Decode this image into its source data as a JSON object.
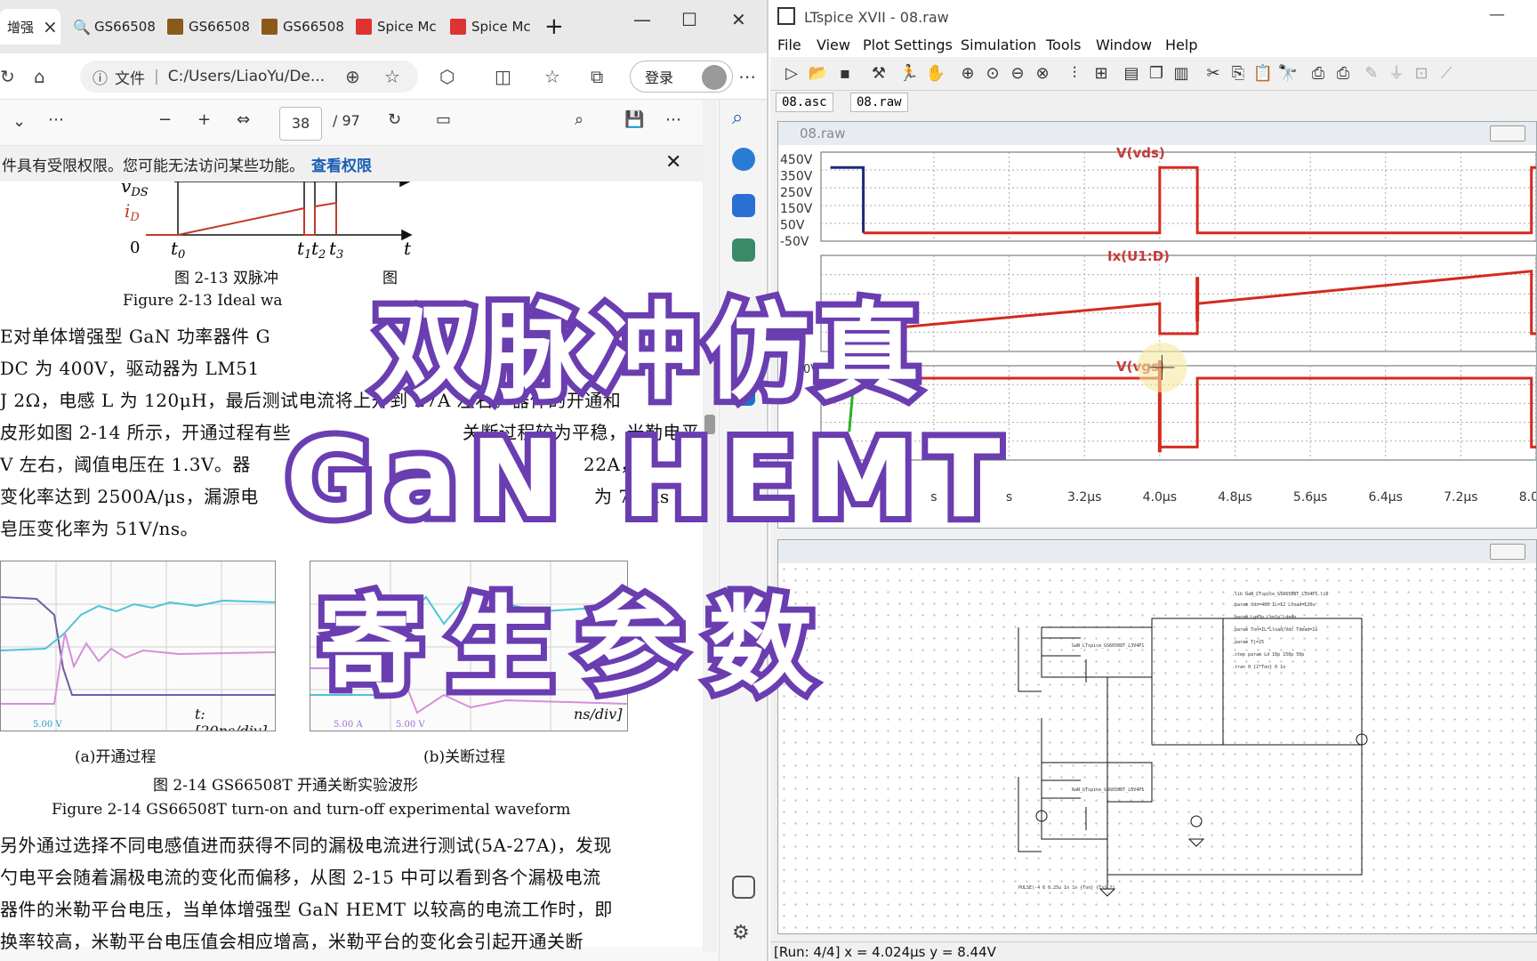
{
  "browser": {
    "tabs": [
      {
        "label": "增强",
        "active": true
      },
      {
        "label": "GS66508"
      },
      {
        "label": "GS66508"
      },
      {
        "label": "GS66508"
      },
      {
        "label": "Spice Mc"
      },
      {
        "label": "Spice Mc"
      }
    ],
    "new_tab": "+",
    "address_prefix": "文件",
    "address": "C:/Users/LiaoYu/De...",
    "login_label": "登录",
    "pdf": {
      "page_current": "38",
      "page_total": "/ 97"
    },
    "infobar": {
      "message": "件具有受限权限。您可能无法访问某些功能。",
      "link": "查看权限"
    },
    "document": {
      "fig213_labels": {
        "vds": "v",
        "vds_sub": "DS",
        "id": "i",
        "id_sub": "D",
        "zero": "0",
        "t0": "t",
        "t0_sub": "0",
        "t1": "t",
        "t1_sub": "1",
        "t2": "t",
        "t2_sub": "2",
        "t3": "t",
        "t3_sub": "3",
        "t": "t"
      },
      "fig213_caption_cn": "图 2-13  双脉冲",
      "fig213_caption_cn_tail": "图",
      "fig213_caption_en": "Figure 2-13 Ideal wa",
      "para1": [
        "E对单体增强型 GaN 功率器件 G",
        "DC 为 400V，驱动器为 LM51",
        "J 2Ω，电感 L 为 120μH，最后测试电流将上升到 27A 左右。器件的开通和",
        "皮形如图 2-14 所示，开通过程有些",
        "V 左右，阈值电压在 1.3V。器",
        "变化率达到 2500A/μs，漏源电",
        "皂压变化率为 51V/ns。"
      ],
      "para1_right": [
        "关断过程较为平稳，米勒电平",
        "22A，",
        "为 7.9ns"
      ],
      "osc_left_label": "t:[20ns/div]",
      "osc_left_tag": "5.00 V",
      "osc_right_label": "ns/div]",
      "osc_right_tag": "5.00 A",
      "osc_right_tag2": "5.00 V",
      "sub_a": "(a)开通过程",
      "sub_b": "(b)关断过程",
      "fig214_caption_cn": "图 2-14 GS66508T 开通关断实验波形",
      "fig214_caption_en": "Figure 2-14 GS66508T turn-on and turn-off experimental waveform",
      "para2": [
        "另外通过选择不同电感值进而获得不同的漏极电流进行测试(5A-27A)，发现",
        "勺电平会随着漏极电流的变化而偏移，从图 2-15 中可以看到各个漏极电流",
        "器件的米勒平台电压，当单体增强型 GaN HEMT 以较高的电流工作时，即",
        "换率较高，米勒平台电压值会相应增高，米勒平台的变化会引起开通关断"
      ]
    }
  },
  "ltspice": {
    "title": "LTspice XVII - 08.raw",
    "menu": [
      "File",
      "View",
      "Plot Settings",
      "Simulation",
      "Tools",
      "Window",
      "Help"
    ],
    "tabs": [
      "08.asc",
      "08.raw"
    ],
    "plot_window_title": "08.raw",
    "status": "[Run: 4/4] x = 4.024µs    y = 8.44V"
  },
  "chart_data": {
    "type": "line",
    "panes": [
      {
        "trace": "V(vds)",
        "yticks": [
          "450V",
          "350V",
          "250V",
          "150V",
          "50V",
          "-50V"
        ],
        "color": "#d42a1e"
      },
      {
        "trace": "Ix(U1:D)",
        "yticks": [],
        "color": "#d42a1e"
      },
      {
        "trace": "V(vgs)",
        "yticks": [
          "0V"
        ],
        "color": "#d42a1e"
      }
    ],
    "x_ticks": [
      "s",
      "s",
      "3.2µs",
      "4.0µs",
      "4.8µs",
      "5.6µs",
      "6.4µs",
      "7.2µs",
      "8.0µs"
    ],
    "x_tick_values_us": [
      1.6,
      2.4,
      3.2,
      4.0,
      4.8,
      5.6,
      6.4,
      7.2,
      8.0
    ],
    "xlim_us": [
      0.4,
      8.0
    ],
    "grid": true,
    "vds_steps_us": [
      [
        0.5,
        400
      ],
      [
        0.85,
        0
      ],
      [
        4.0,
        400
      ],
      [
        4.4,
        0
      ],
      [
        8.0,
        400
      ]
    ],
    "vds_low_v": 0,
    "id_ramp_a": [
      [
        0.85,
        0
      ],
      [
        4.0,
        13
      ],
      [
        4.4,
        13
      ],
      [
        8.0,
        27
      ]
    ],
    "vgs_levels": [
      [
        0.7,
        -1
      ],
      [
        0.85,
        6
      ],
      [
        4.0,
        -3
      ],
      [
        4.4,
        6
      ],
      [
        8.0,
        -3
      ]
    ]
  },
  "overlay": {
    "line1": "双脉冲仿真",
    "line2": "GaN HEMT",
    "line3": "寄生参数"
  },
  "colors": {
    "overlay_fill": "#ffffff",
    "overlay_stroke": "#6a3db1",
    "trace": "#d42a1e",
    "vds_initial": "#1a2a7a",
    "vgs_initial": "#2ab02a"
  }
}
